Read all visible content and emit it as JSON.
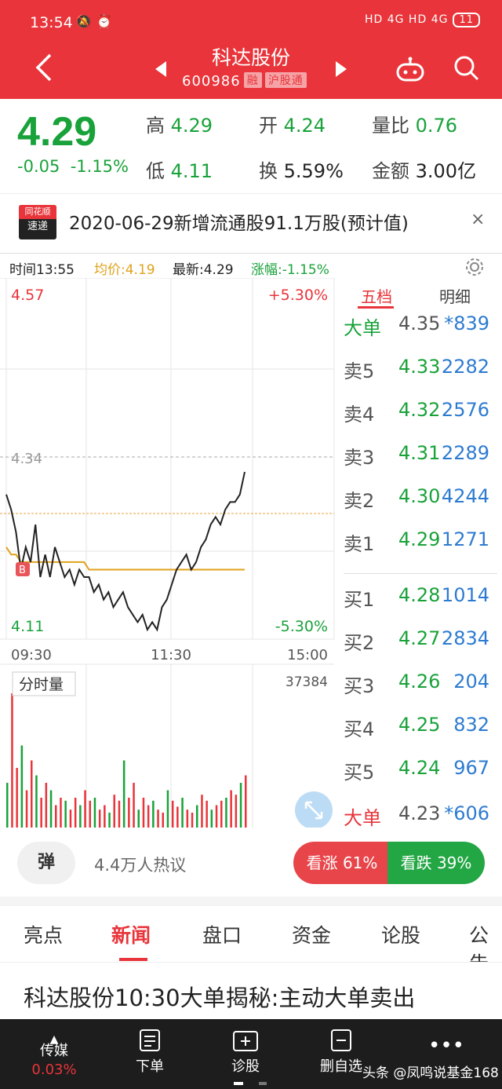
{
  "status_bar": {
    "time": "13:54",
    "signal": "HD 4G HD 4G",
    "battery": "11"
  },
  "header": {
    "title": "科达股份",
    "code": "600986",
    "tags": [
      "融",
      "沪股通"
    ]
  },
  "quote": {
    "price": "4.29",
    "change": "-0.05",
    "change_pct": "-1.15%",
    "high_label": "高",
    "high": "4.29",
    "open_label": "开",
    "open": "4.24",
    "vr_label": "量比",
    "vr": "0.76",
    "low_label": "低",
    "low": "4.11",
    "turn_label": "换",
    "turn": "5.59%",
    "amt_label": "金额",
    "amt": "3.00亿"
  },
  "banner": {
    "logo_top": "同花顺",
    "logo_bottom": "速递",
    "text": "2020-06-29新增流通股91.1万股(预计值)",
    "close": "×"
  },
  "info_row": {
    "time": "时间13:55",
    "avg": "均价:4.19",
    "latest": "最新:4.29",
    "pct": "涨幅:-1.15%"
  },
  "chart_labels": {
    "top_price": "4.57",
    "top_pct": "+5.30%",
    "mid": "4.34",
    "bottom_price": "4.11",
    "bottom_pct": "-5.30%",
    "t0": "09:30",
    "t1": "11:30",
    "t2": "15:00",
    "vol_label": "分时量",
    "vol_max": "37384",
    "b_marker": "B"
  },
  "chart_data": {
    "type": "line",
    "title": "",
    "ylim": [
      4.11,
      4.57
    ],
    "reference": 4.34,
    "series": [
      {
        "name": "",
        "values": [
          4.29,
          4.27,
          4.24,
          4.19,
          4.22,
          4.2,
          4.25,
          4.18,
          4.21,
          4.18,
          4.22,
          4.2,
          4.18,
          4.19,
          4.17,
          4.19,
          4.18,
          4.18,
          4.16,
          4.17,
          4.15,
          4.16,
          4.14,
          4.15,
          4.16,
          4.14,
          4.13,
          4.12,
          4.13,
          4.11,
          4.12,
          4.11,
          4.14,
          4.15,
          4.17,
          4.19,
          4.2,
          4.21,
          4.19,
          4.2,
          4.22,
          4.23,
          4.25,
          4.26,
          4.25,
          4.27,
          4.28,
          4.28,
          4.29,
          4.32
        ]
      },
      {
        "name": "",
        "values": [
          4.22,
          4.21,
          4.21,
          4.2,
          4.2,
          4.2,
          4.2,
          4.2,
          4.2,
          4.2,
          4.2,
          4.2,
          4.2,
          4.2,
          4.2,
          4.2,
          4.2,
          4.19,
          4.19,
          4.19,
          4.19,
          4.19,
          4.19,
          4.19,
          4.19,
          4.19,
          4.19,
          4.19,
          4.19,
          4.19,
          4.19,
          4.19,
          4.19,
          4.19,
          4.19,
          4.19,
          4.19,
          4.19,
          4.19,
          4.19,
          4.19,
          4.19,
          4.19,
          4.19,
          4.19,
          4.19,
          4.19,
          4.19,
          4.19,
          4.19
        ]
      }
    ],
    "volume": [
      0.3,
      0.9,
      0.4,
      0.55,
      0.25,
      0.45,
      0.35,
      0.2,
      0.3,
      0.25,
      0.15,
      0.2,
      0.18,
      0.12,
      0.2,
      0.15,
      0.25,
      0.18,
      0.2,
      0.12,
      0.15,
      0.1,
      0.22,
      0.18,
      0.45,
      0.2,
      0.3,
      0.12,
      0.2,
      0.15,
      0.18,
      0.12,
      0.1,
      0.25,
      0.18,
      0.14,
      0.2,
      0.12,
      0.1,
      0.15,
      0.22,
      0.18,
      0.12,
      0.15,
      0.18,
      0.2,
      0.25,
      0.22,
      0.3,
      0.35
    ]
  },
  "orderbook": {
    "tab1": "五档",
    "tab2": "明细",
    "rows": [
      {
        "l": "大单",
        "p": "4.35",
        "v": "*839"
      },
      {
        "l": "卖5",
        "p": "4.33",
        "v": "2282"
      },
      {
        "l": "卖4",
        "p": "4.32",
        "v": "2576"
      },
      {
        "l": "卖3",
        "p": "4.31",
        "v": "2289"
      },
      {
        "l": "卖2",
        "p": "4.30",
        "v": "4244"
      },
      {
        "l": "卖1",
        "p": "4.29",
        "v": "1271"
      },
      {
        "l": "买1",
        "p": "4.28",
        "v": "1014"
      },
      {
        "l": "买2",
        "p": "4.27",
        "v": "2834"
      },
      {
        "l": "买3",
        "p": "4.26",
        "v": "204"
      },
      {
        "l": "买4",
        "p": "4.25",
        "v": "832"
      },
      {
        "l": "买5",
        "p": "4.24",
        "v": "967"
      },
      {
        "l": "大单",
        "p": "4.23",
        "v": "*606"
      }
    ]
  },
  "sentiment": {
    "dan": "弹",
    "hot": "4.4万人热议",
    "up": "看涨 61%",
    "down": "看跌 39%"
  },
  "news_tabs": [
    "亮点",
    "新闻",
    "盘口",
    "资金",
    "论股",
    "公告"
  ],
  "headline": "科达股份10:30大单揭秘:主动大单卖出",
  "bottom_nav": [
    {
      "label": "传媒",
      "sub": "0.03%"
    },
    {
      "label": "下单"
    },
    {
      "label": "诊股"
    },
    {
      "label": "删自选"
    },
    {
      "label": ""
    }
  ],
  "watermark": "头条 @凤鸣说基金168",
  "colors": {
    "red": "#e8343a",
    "green": "#19a23a",
    "blue": "#2d7bd1",
    "avg": "#e0a21a"
  }
}
